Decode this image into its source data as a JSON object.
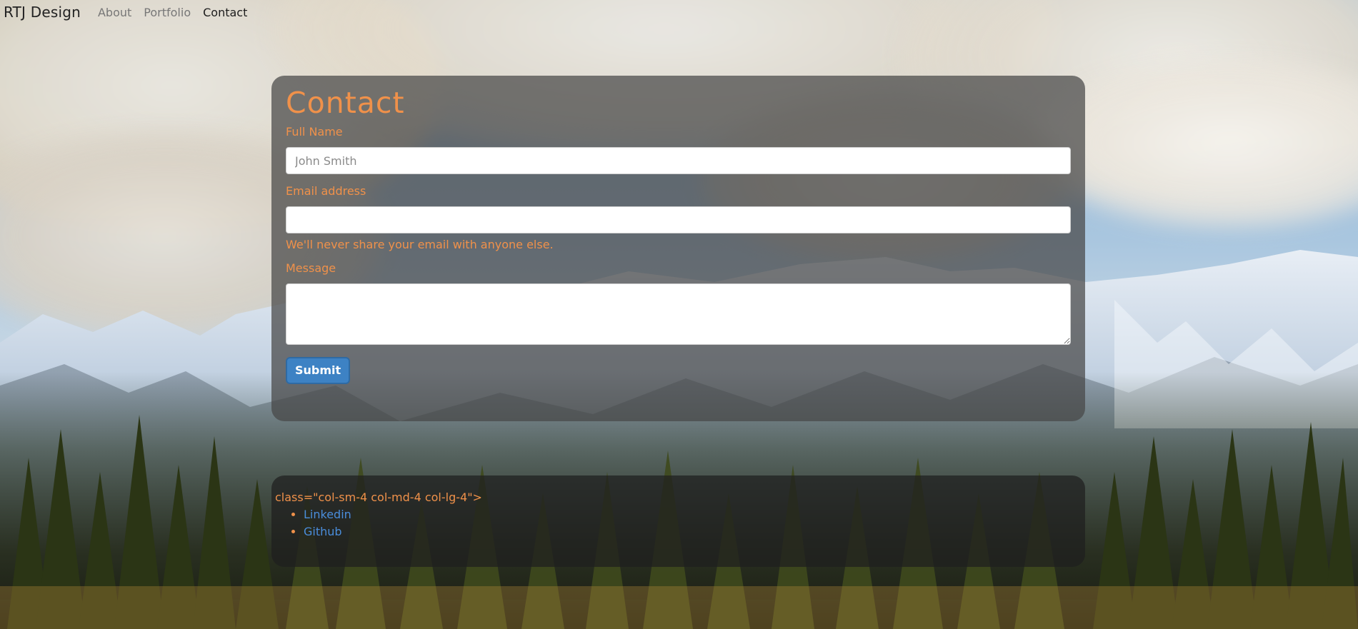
{
  "navbar": {
    "brand": "RTJ Design",
    "links": [
      {
        "label": "About",
        "active": false
      },
      {
        "label": "Portfolio",
        "active": false
      },
      {
        "label": "Contact",
        "active": true
      }
    ]
  },
  "contact_form": {
    "title": "Contact",
    "full_name": {
      "label": "Full Name",
      "placeholder": "John Smith",
      "value": ""
    },
    "email": {
      "label": "Email address",
      "placeholder": "",
      "value": "",
      "help": "We'll never share your email with anyone else."
    },
    "message": {
      "label": "Message",
      "placeholder": "",
      "value": ""
    },
    "submit_label": "Submit"
  },
  "footer": {
    "stray_text": "class=\"col-sm-4 col-md-4 col-lg-4\">",
    "links": [
      {
        "label": "Linkedin"
      },
      {
        "label": "Github"
      }
    ]
  },
  "colors": {
    "accent_orange": "#f0914a",
    "link_blue": "#4a8ddb",
    "button_blue": "#3d82c4",
    "panel_overlay": "#464646"
  }
}
